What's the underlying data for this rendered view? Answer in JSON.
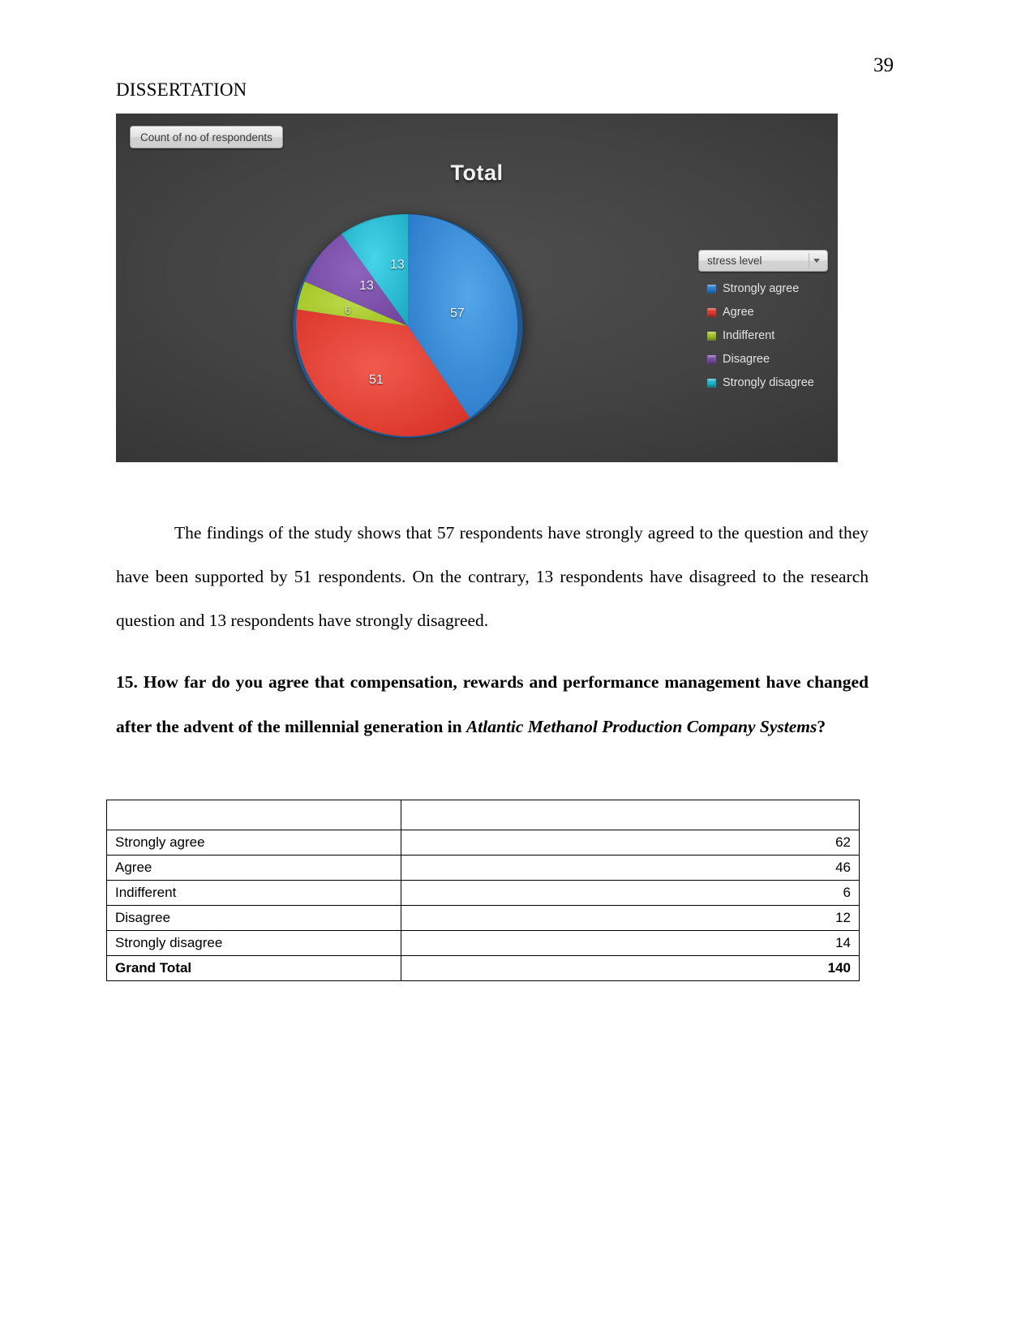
{
  "page": {
    "number": "39",
    "header": "DISSERTATION"
  },
  "figure": {
    "field_button_label": "Count of no of respondents",
    "title": "Total",
    "legend_field_label": "stress level",
    "legend_items": [
      {
        "label": "Strongly agree",
        "color": "#2a7fd4"
      },
      {
        "label": "Agree",
        "color": "#e03a2f"
      },
      {
        "label": "Indifferent",
        "color": "#a4c628"
      },
      {
        "label": "Disagree",
        "color": "#7b4fa8"
      },
      {
        "label": "Strongly disagree",
        "color": "#21b7cf"
      }
    ],
    "slice_labels": {
      "strongly_agree": "57",
      "agree": "51",
      "indifferent": "6",
      "disagree": "13",
      "strongly_disagree": "13"
    }
  },
  "chart_data": {
    "type": "pie",
    "title": "Total",
    "categories": [
      "Strongly agree",
      "Agree",
      "Indifferent",
      "Disagree",
      "Strongly disagree"
    ],
    "values": [
      57,
      51,
      6,
      13,
      13
    ],
    "colors": [
      "#2a7fd4",
      "#e03a2f",
      "#a4c628",
      "#7b4fa8",
      "#21b7cf"
    ],
    "total": 140,
    "legend_position": "right",
    "legend_title": "stress level",
    "data_labels": true,
    "value_field": "Count of no of respondents",
    "grid": false
  },
  "body": {
    "findings_paragraph": "The findings of the study shows that 57 respondents have strongly agreed to the question and they have been supported by 51 respondents. On the contrary, 13 respondents have disagreed to the research question and 13 respondents have strongly disagreed."
  },
  "question": {
    "number": "15.",
    "text_before_italic": "How far do you agree that compensation, rewards and performance management have changed after the advent of the millennial generation in ",
    "italic_part": "Atlantic Methanol Production Company Systems",
    "text_after_italic": "?"
  },
  "table": {
    "header": {
      "label": "",
      "value": ""
    },
    "rows": [
      {
        "label": "Strongly agree",
        "value": "62"
      },
      {
        "label": "Agree",
        "value": "46"
      },
      {
        "label": "Indifferent",
        "value": "6"
      },
      {
        "label": "Disagree",
        "value": "12"
      },
      {
        "label": "Strongly disagree",
        "value": "14"
      }
    ],
    "total_row": {
      "label": "Grand Total",
      "value": "140"
    }
  }
}
